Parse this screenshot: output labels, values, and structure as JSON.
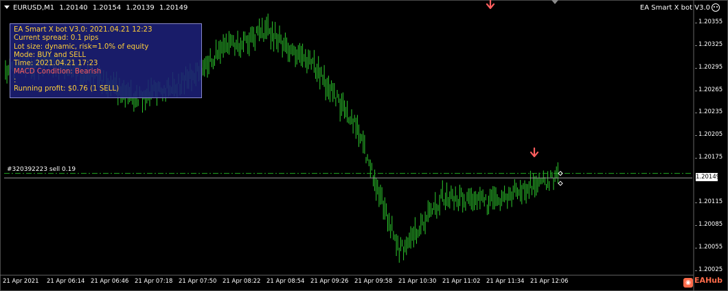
{
  "symbol_info": {
    "symbol": "EURUSD,M1",
    "open": "1.20140",
    "high": "1.20154",
    "low": "1.20139",
    "close": "1.20149"
  },
  "expert": {
    "name": "EA Smart X bot V3.0"
  },
  "info_panel": {
    "lines": [
      "EA Smart X bot V3.0: 2021.04.21 12:23",
      "Current spread: 0.1 pips",
      "Lot size: dynamic, risk=1.0% of equity",
      "Mode: BUY and SELL",
      "Time: 2021.04.21 17:23",
      "MACD Condition: Bearish",
      ":",
      "Running profit: $0.76 (1 SELL)"
    ]
  },
  "order_label": "#320392223 sell 0.19",
  "price_axis": {
    "ticks": [
      "1.20355",
      "1.20325",
      "1.20295",
      "1.20265",
      "1.20235",
      "1.20205",
      "1.20175",
      "1.20115",
      "1.20085",
      "1.20055",
      "1.20025"
    ],
    "current_price": "1.20149"
  },
  "time_axis": {
    "ticks": [
      "21 Apr 2021",
      "21 Apr 06:14",
      "21 Apr 06:46",
      "21 Apr 07:18",
      "21 Apr 07:50",
      "21 Apr 08:22",
      "21 Apr 08:54",
      "21 Apr 09:26",
      "21 Apr 09:58",
      "21 Apr 10:30",
      "21 Apr 11:02",
      "21 Apr 11:34",
      "21 Apr 12:06"
    ]
  },
  "watermark": "EAHub",
  "colors": {
    "bars": "#2ecc2e",
    "panel_text": "#ffcf3a",
    "panel_alert": "#ff5d5d",
    "signal_arrow": "#ff5e5e",
    "order_line": "#22aa22"
  },
  "chart_data": {
    "type": "line",
    "x": [
      "21 Apr 2021",
      "21 Apr 06:14",
      "21 Apr 06:46",
      "21 Apr 07:18",
      "21 Apr 07:50",
      "21 Apr 08:22",
      "21 Apr 08:54",
      "21 Apr 09:26",
      "21 Apr 09:58",
      "21 Apr 10:30",
      "21 Apr 11:02",
      "21 Apr 11:34",
      "21 Apr 12:06",
      "21 Apr 12:23"
    ],
    "series": [
      {
        "values": [
          1.2029,
          1.20305,
          1.20285,
          1.20255,
          1.20275,
          1.2032,
          1.20345,
          1.203,
          1.2022,
          1.2005,
          1.20125,
          1.20115,
          1.2014,
          1.20149
        ]
      }
    ],
    "ylim": [
      1.2002,
      1.2037
    ],
    "sell_order_price": 1.20155,
    "signal_arrows": [
      {
        "x": "21 Apr 11:34",
        "y": 1.20385
      },
      {
        "x": "21 Apr 12:06",
        "y": 1.20185
      }
    ],
    "grid": false
  }
}
